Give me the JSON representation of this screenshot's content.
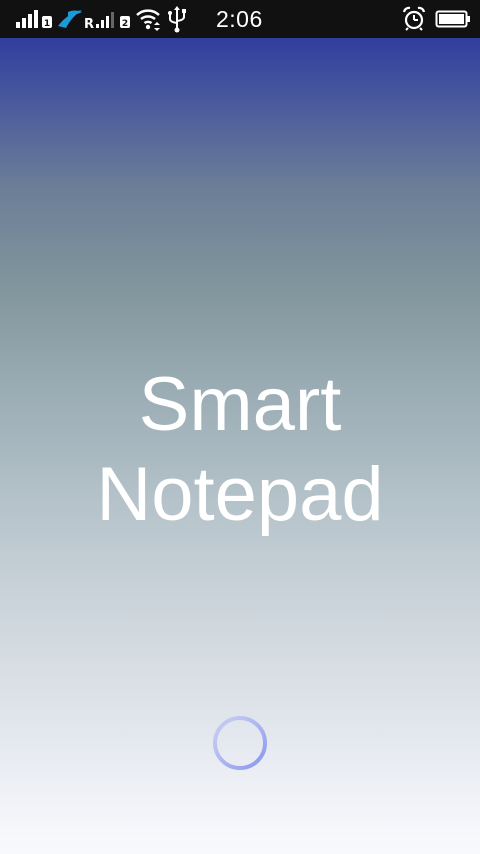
{
  "status_bar": {
    "time": "2:06",
    "sim1_label": "1",
    "sim2_label": "2",
    "roaming_label": "R",
    "icons": [
      "signal-sim1-icon",
      "telenor-icon",
      "signal-sim2-icon",
      "wifi-icon",
      "usb-icon",
      "alarm-icon",
      "battery-icon"
    ]
  },
  "splash": {
    "title_line1": "Smart",
    "title_line2": "Notepad"
  },
  "colors": {
    "status_bar_bg": "#111111",
    "gradient_top": "#313e9e",
    "gradient_bottom": "#f8f9fc",
    "spinner": "#9aa6f2"
  }
}
